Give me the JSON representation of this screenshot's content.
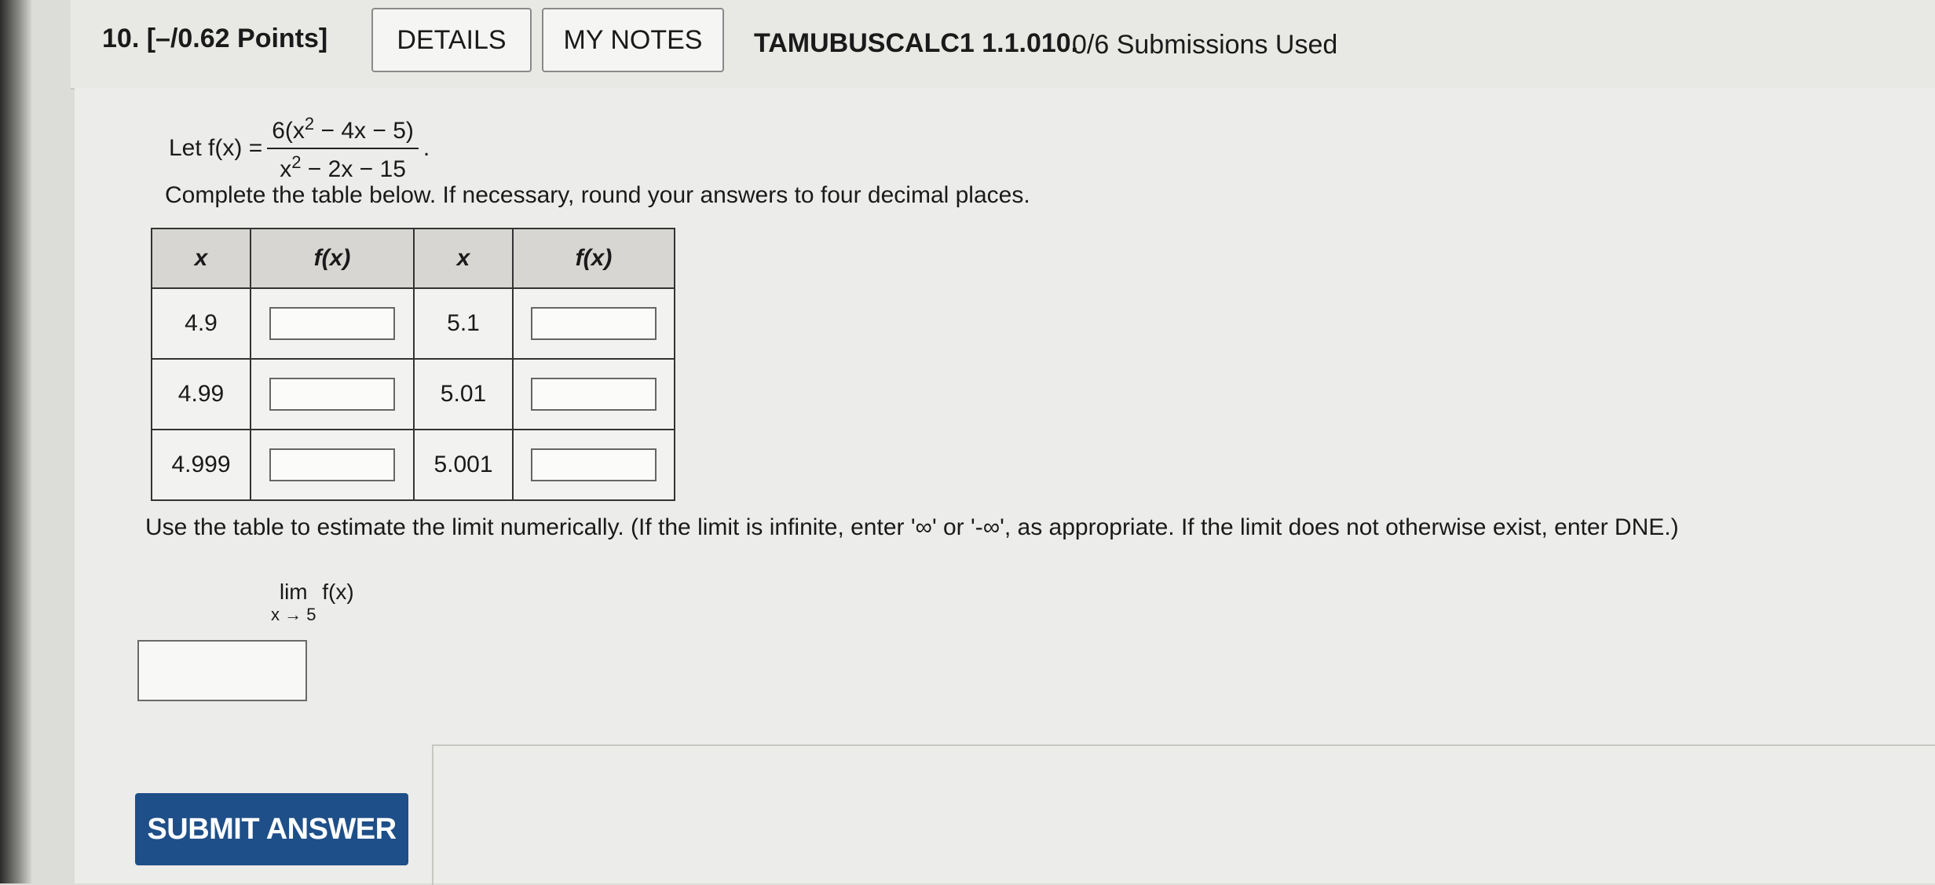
{
  "header": {
    "question_number": "10.",
    "points": "[–/0.62 Points]",
    "details_label": "DETAILS",
    "my_notes_label": "MY NOTES",
    "problem_code": "TAMUBUSCALC1 1.1.010.",
    "submissions": "0/6 Submissions Used"
  },
  "problem": {
    "let_text": "Let f(x) =",
    "numerator_a": "6(x",
    "numerator_exp": "2",
    "numerator_b": " − 4x − 5)",
    "denominator_a": "x",
    "denominator_exp": "2",
    "denominator_b": " − 2x − 15",
    "period": ".",
    "instruction": "Complete the table below. If necessary, round your answers to four decimal places."
  },
  "table": {
    "headers": [
      "x",
      "f(x)",
      "x",
      "f(x)"
    ],
    "rows": [
      {
        "x_left": "4.9",
        "x_right": "5.1"
      },
      {
        "x_left": "4.99",
        "x_right": "5.01"
      },
      {
        "x_left": "4.999",
        "x_right": "5.001"
      }
    ]
  },
  "limit": {
    "instruction": "Use the table to estimate the limit numerically. (If the limit is infinite, enter '∞' or '-∞', as appropriate. If the limit does not otherwise exist, enter DNE.)",
    "lim_word": "lim",
    "lim_sub": "x → 5",
    "lim_fn": "f(x)"
  },
  "submit_label": "SUBMIT ANSWER"
}
